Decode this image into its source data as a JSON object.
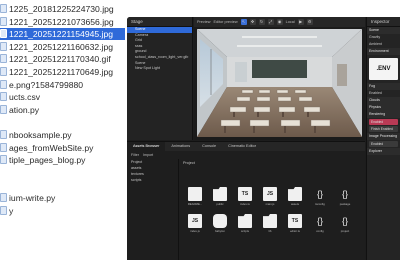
{
  "files": [
    {
      "name": "1225_20181225224730.jpg",
      "selected": false
    },
    {
      "name": "1221_20251221073656.jpg",
      "selected": false
    },
    {
      "name": "1221_20251221154945.jpg",
      "selected": true
    },
    {
      "name": "1221_20251221160632.jpg",
      "selected": false
    },
    {
      "name": "1221_20251221170340.gif",
      "selected": false
    },
    {
      "name": "1221_20251221170649.jpg",
      "selected": false
    },
    {
      "name": "e.png?1584799880",
      "selected": false
    },
    {
      "name": "ucts.csv",
      "selected": false
    },
    {
      "name": "ation.py",
      "selected": false
    },
    {
      "name": "",
      "selected": false
    },
    {
      "name": "nbooksample.py",
      "selected": false
    },
    {
      "name": "ages_fromWebSite.py",
      "selected": false
    },
    {
      "name": "tiple_pages_blog.py",
      "selected": false
    },
    {
      "name": "",
      "selected": false
    },
    {
      "name": "",
      "selected": false
    },
    {
      "name": "ium-write.py",
      "selected": false
    },
    {
      "name": "y",
      "selected": false
    }
  ],
  "editor": {
    "stage": {
      "title": "Stage",
      "items": [
        {
          "label": "Scene",
          "selected": true
        },
        {
          "label": "Camera",
          "selected": false
        },
        {
          "label": "Grid",
          "selected": false
        },
        {
          "label": "ssss",
          "selected": false
        },
        {
          "label": "ground",
          "selected": false
        },
        {
          "label": "school_class_room_light_ver.glb",
          "selected": false
        },
        {
          "label": "Scene",
          "selected": false
        },
        {
          "label": "New Spot Light",
          "selected": false
        }
      ]
    },
    "preview": {
      "title": "Preview",
      "toolbar_label": "Editor preview",
      "mode_label": "Local"
    },
    "inspector": {
      "title": "Inspector",
      "rows": [
        "Scene",
        "Gravity",
        "Ambient"
      ],
      "env_label": ".ENV",
      "sections": [
        "Environment",
        "Fog",
        "Enabled",
        "Clouds",
        "Physics",
        "Rendering",
        "Explorer"
      ],
      "buttons": [
        {
          "label": "Enabled",
          "active": true
        },
        {
          "label": "Finish Enabled",
          "active": false
        },
        {
          "label": "Image Processing",
          "active": false
        },
        {
          "label": "Enabled",
          "active": false
        }
      ]
    },
    "bottom_tabs": [
      {
        "label": "Assets Browser",
        "active": true
      },
      {
        "label": "Animations",
        "active": false
      },
      {
        "label": "Console",
        "active": false
      },
      {
        "label": "Cinematic Editor",
        "active": false
      }
    ],
    "asset_toolbar": [
      "Filter",
      "Import"
    ],
    "project_tree": [
      "Project",
      "assets",
      "textures",
      "scripts"
    ],
    "grid_header": "Project",
    "assets": [
      {
        "name": "README...",
        "kind": "file",
        "glyph": ""
      },
      {
        "name": "public",
        "kind": "folder",
        "glyph": ""
      },
      {
        "name": "index.ts",
        "kind": "ts",
        "glyph": "TS"
      },
      {
        "name": "main.js",
        "kind": "js",
        "glyph": "JS"
      },
      {
        "name": "assets",
        "kind": "folder",
        "glyph": ""
      },
      {
        "name": "tsconfig",
        "kind": "braces",
        "glyph": "{}"
      },
      {
        "name": "package",
        "kind": "braces",
        "glyph": "{}"
      },
      {
        "name": "index.js",
        "kind": "js",
        "glyph": "JS"
      },
      {
        "name": "babylon",
        "kind": "shield",
        "glyph": ""
      },
      {
        "name": "scripts",
        "kind": "folder",
        "glyph": ""
      },
      {
        "name": "lib",
        "kind": "folder",
        "glyph": ""
      },
      {
        "name": "editor.ts",
        "kind": "ts",
        "glyph": "TS"
      },
      {
        "name": "config",
        "kind": "braces",
        "glyph": "{}"
      },
      {
        "name": "project",
        "kind": "braces",
        "glyph": "{}"
      }
    ]
  },
  "colors": {
    "selection": "#2f6ad9",
    "editor_bg": "#1d1d1d",
    "active_button": "#b93a55"
  }
}
